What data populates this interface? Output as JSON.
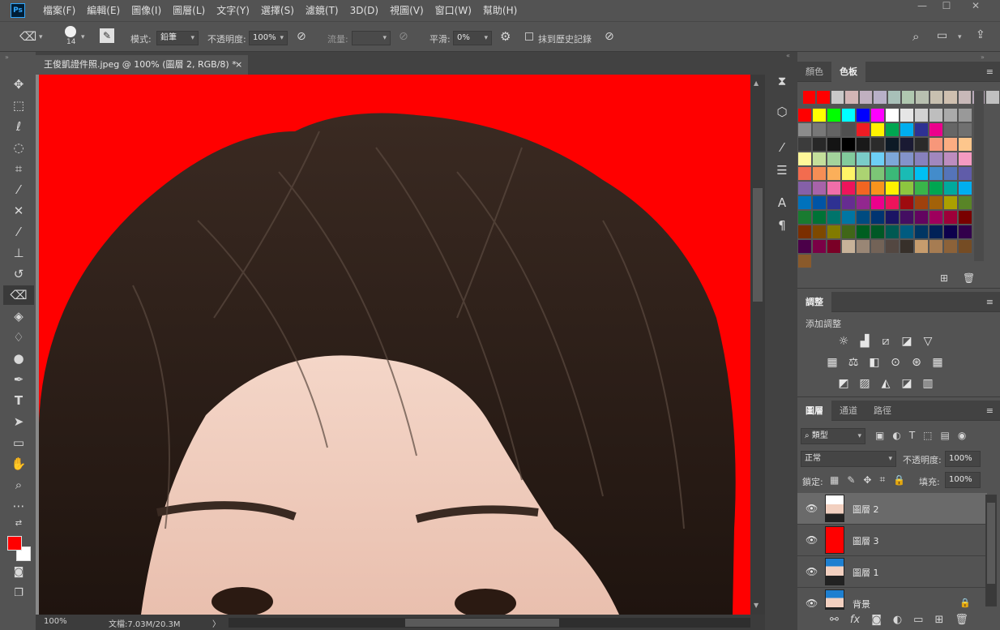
{
  "app": {
    "logo": "Ps"
  },
  "menu": [
    "檔案(F)",
    "編輯(E)",
    "圖像(I)",
    "圖層(L)",
    "文字(Y)",
    "選擇(S)",
    "濾鏡(T)",
    "3D(D)",
    "視圖(V)",
    "窗口(W)",
    "幫助(H)"
  ],
  "window_controls": {
    "minimize": "—",
    "maximize": "☐",
    "close": "✕"
  },
  "options": {
    "brush_size": "14",
    "mode_label": "模式:",
    "mode_value": "鉛筆",
    "opacity_label": "不透明度:",
    "opacity_value": "100%",
    "flow_label": "流量:",
    "smoothing_label": "平滑:",
    "smoothing_value": "0%",
    "erase_history_label": "抹到歷史記錄"
  },
  "document": {
    "tab_title": "王俊凱證件照.jpeg @ 100% (圖層 2, RGB/8) *",
    "close": "×"
  },
  "status": {
    "zoom": "100%",
    "doc_info": "文檔:7.03M/20.3M",
    "arrow": "〉"
  },
  "swatches_panel": {
    "tabs": [
      "顏色",
      "色板"
    ],
    "active_tab": "色板",
    "recent": [
      "#ff0000",
      "#ff0000",
      "#c9c9c9",
      "#d2b5b5",
      "#c0b0c0",
      "#b8b0c8",
      "#a8c0b8",
      "#b0c8b0",
      "#b8c0b0",
      "#c8c0b0",
      "#d0c0b0",
      "#c8b8b8",
      "#b8a8b8",
      "#c0c0c0"
    ],
    "rows": [
      [
        "#ff0000",
        "#ffff00",
        "#00ff00",
        "#00ffff",
        "#0000ff",
        "#ff00ff",
        "#ffffff",
        "#e6e6e6",
        "#d2d2d2",
        "#bebebe",
        "#aaaaaa",
        "#999999"
      ],
      [
        "#8c8c8c",
        "#787878",
        "#646464",
        "#505050",
        "#ed1c24",
        "#fff200",
        "#00a651",
        "#00aeef",
        "#2e3192",
        "#ec008c",
        "#666666",
        "#707070"
      ],
      [
        "#3c3c3c",
        "#282828",
        "#141414",
        "#000000",
        "#191919",
        "#2b2b2b",
        "#0d1a26",
        "#1a1a33",
        "#2a2a2a",
        "#f7977a",
        "#fbad82",
        "#fdc68c"
      ],
      [
        "#fff799",
        "#c4df9b",
        "#a3d39c",
        "#82ca9c",
        "#7accc8",
        "#6dcff6",
        "#7da7d9",
        "#8393ca",
        "#8781bd",
        "#a187be",
        "#bd8cbf",
        "#f49ac1"
      ],
      [
        "#f26c4f",
        "#f68e55",
        "#fbaf5a",
        "#fff467",
        "#acd372",
        "#7cc576",
        "#3bb878",
        "#1abbb4",
        "#00bff3",
        "#438ccb",
        "#5574b9",
        "#605ca9"
      ],
      [
        "#8560a8",
        "#a763a9",
        "#f06ea9",
        "#ed145b",
        "#f26522",
        "#f7941d",
        "#fff200",
        "#8dc63f",
        "#39b54a",
        "#00a651",
        "#00a99d",
        "#00aeef"
      ],
      [
        "#0072bc",
        "#0054a5",
        "#2e3192",
        "#662d91",
        "#92278f",
        "#ec008c",
        "#ed145b",
        "#9e0b0f",
        "#a0410d",
        "#a36209",
        "#aba000",
        "#598527"
      ],
      [
        "#197b30",
        "#007236",
        "#00746b",
        "#0076a3",
        "#004b80",
        "#003471",
        "#1b1464",
        "#440e62",
        "#630460",
        "#9e005d",
        "#9e0039",
        "#790000"
      ],
      [
        "#7b2e00",
        "#7d4900",
        "#827b00",
        "#406618",
        "#005e20",
        "#005826",
        "#005952",
        "#005b7f",
        "#003663",
        "#002157",
        "#0d004c",
        "#32004b"
      ],
      [
        "#4b0049",
        "#7b0046",
        "#7a0026",
        "#c7b299",
        "#998675",
        "#736357",
        "#534741",
        "#37302a",
        "#c69c6d",
        "#a67c52",
        "#8c6239",
        "#754c24"
      ],
      [
        "#8a5a2b"
      ]
    ]
  },
  "adjustments_panel": {
    "tab": "調整",
    "add_label": "添加調整"
  },
  "layers_panel": {
    "tabs": [
      "圖層",
      "通道",
      "路徑"
    ],
    "active_tab": "圖層",
    "filter_kind": "類型",
    "blend_mode": "正常",
    "opacity_label": "不透明度:",
    "opacity_value": "100%",
    "lock_label": "鎖定:",
    "fill_label": "填充:",
    "fill_value": "100%",
    "layers": [
      {
        "name": "圖層 2",
        "selected": true,
        "thumb": "portrait-white"
      },
      {
        "name": "圖層 3",
        "selected": false,
        "thumb": "red"
      },
      {
        "name": "圖層 1",
        "selected": false,
        "thumb": "portrait-blue"
      },
      {
        "name": "背景",
        "selected": false,
        "thumb": "portrait-blue"
      }
    ]
  },
  "colors": {
    "foreground": "#ff0000",
    "background": "#ffffff",
    "canvas_bg": "#ff0000",
    "hair": "#2a1c16"
  }
}
